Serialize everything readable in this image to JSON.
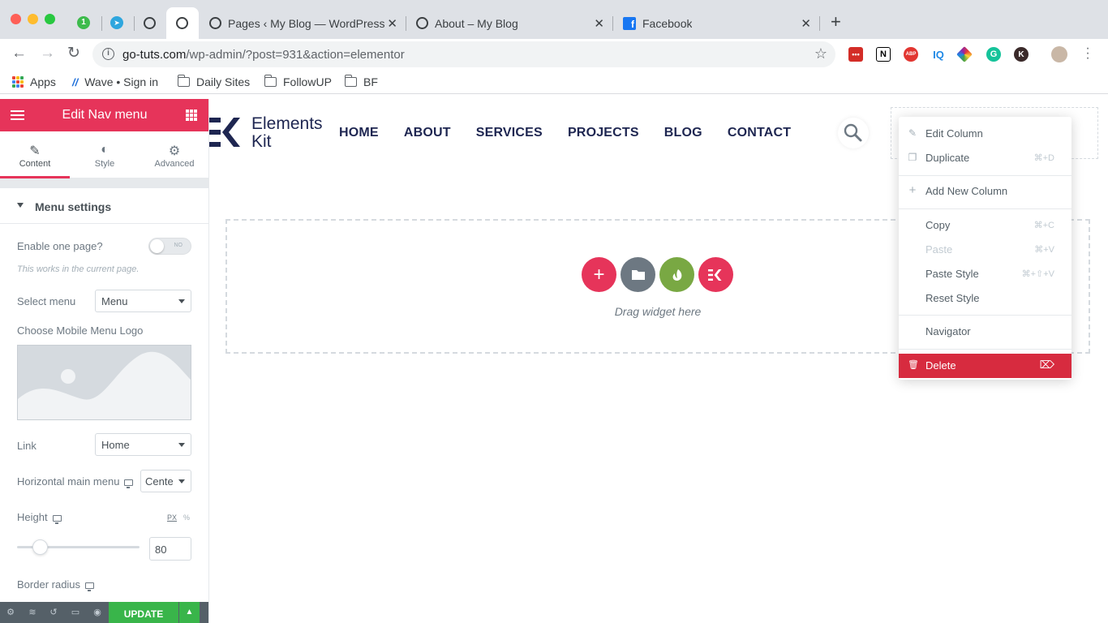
{
  "browser": {
    "tabs": [
      {
        "title": "Pages ‹ My Blog — WordPress",
        "close": "✕"
      },
      {
        "title": "About – My Blog",
        "close": "✕"
      },
      {
        "title": "Facebook",
        "close": "✕"
      }
    ],
    "pinned_badge": "1",
    "new_tab": "+",
    "url_host": "go-tuts.com",
    "url_path": "/wp-admin/?post=931&action=elementor",
    "bookmarks": [
      "Apps",
      "Wave • Sign in",
      "Daily Sites",
      "FollowUP",
      "BF"
    ],
    "extensions": [
      {
        "name": "lastpass-icon",
        "text": "•••",
        "color": "#d32d27"
      },
      {
        "name": "notion-icon",
        "text": "N",
        "color": "#ffffff"
      },
      {
        "name": "adblock-icon",
        "text": "ABP",
        "color": "#e23631"
      },
      {
        "name": "iq-icon",
        "text": "IQ",
        "color": "#ffffff"
      },
      {
        "name": "colorpick-icon",
        "text": "",
        "color": "#7b3fe4"
      },
      {
        "name": "grammarly-icon",
        "text": "G",
        "color": "#15c39a"
      },
      {
        "name": "k-icon",
        "text": "K",
        "color": "#3b2a2a"
      }
    ]
  },
  "panel": {
    "title": "Edit Nav menu",
    "tabs": [
      {
        "label": "Content",
        "icon": "pencil-icon",
        "glyph": "✎"
      },
      {
        "label": "Style",
        "icon": "contrast-icon",
        "glyph": "◐"
      },
      {
        "label": "Advanced",
        "icon": "gear-icon",
        "glyph": "⚙"
      }
    ],
    "section_title": "Menu settings",
    "enable_one_page": {
      "label": "Enable one page?",
      "toggle": "NO",
      "note": "This works in the current page."
    },
    "select_menu": {
      "label": "Select menu",
      "value": "Menu"
    },
    "mobile_logo": {
      "label": "Choose Mobile Menu Logo"
    },
    "link": {
      "label": "Link",
      "value": "Home"
    },
    "horizontal_menu": {
      "label": "Horizontal main menu",
      "value": "Center"
    },
    "height": {
      "label": "Height",
      "unit_px": "PX",
      "unit_pct": "%",
      "value": "80",
      "slider_fraction": 0.19
    },
    "border_radius": {
      "label": "Border radius"
    },
    "footer": {
      "update": "UPDATE",
      "arrow": "▲"
    }
  },
  "canvas": {
    "logo_line1": "Elements",
    "logo_line2": "Kit",
    "nav": [
      "HOME",
      "ABOUT",
      "SERVICES",
      "PROJECTS",
      "BLOG",
      "CONTACT"
    ],
    "drag_text": "Drag widget here",
    "colors": {
      "add": "#e6345a",
      "template": "#6d7882",
      "envato": "#79a843",
      "ek": "#e6345a",
      "brand": "#1e2651"
    }
  },
  "context_menu": {
    "items": [
      {
        "label": "Edit Column",
        "icon": "✎",
        "shortcut": "",
        "disabled": false
      },
      {
        "label": "Duplicate",
        "icon": "❐",
        "shortcut": "⌘+D",
        "disabled": false
      },
      {
        "label": "Add New Column",
        "icon": "+",
        "shortcut": "",
        "disabled": false
      },
      {
        "label": "Copy",
        "icon": "",
        "shortcut": "⌘+C",
        "disabled": false
      },
      {
        "label": "Paste",
        "icon": "",
        "shortcut": "⌘+V",
        "disabled": true
      },
      {
        "label": "Paste Style",
        "icon": "",
        "shortcut": "⌘+⇧+V",
        "disabled": false
      },
      {
        "label": "Reset Style",
        "icon": "",
        "shortcut": "",
        "disabled": false
      },
      {
        "label": "Navigator",
        "icon": "",
        "shortcut": "",
        "disabled": false
      },
      {
        "label": "Delete",
        "icon": "🗑",
        "shortcut": "⌦",
        "disabled": false
      }
    ]
  }
}
